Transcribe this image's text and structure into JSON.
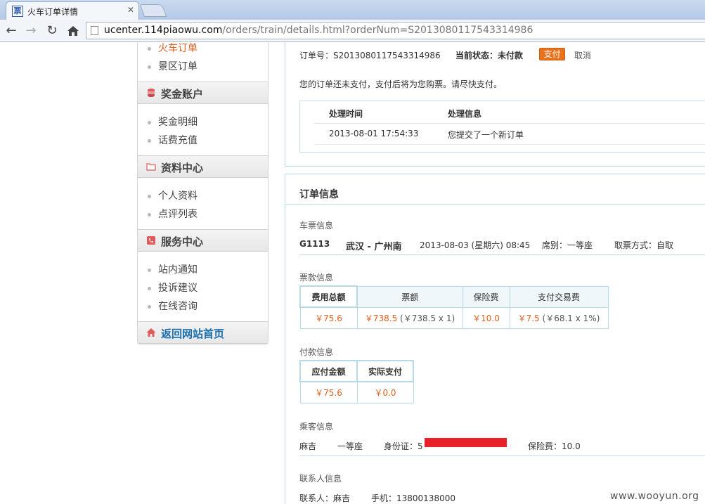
{
  "browser": {
    "tab_title": "火车订单详情",
    "tab_favicon": "票",
    "tab_close": "✕",
    "url_host": "ucenter.114piaowu.com",
    "url_path": "/orders/train/details.html?orderNum=S2013080117543314986"
  },
  "sidebar": {
    "items_top": [
      {
        "label": "火车订单",
        "active": true
      },
      {
        "label": "景区订单"
      }
    ],
    "section_bonus": "奖金账户",
    "items_bonus": [
      "奖金明细",
      "话费充值"
    ],
    "section_profile": "资料中心",
    "items_profile": [
      "个人资料",
      "点评列表"
    ],
    "section_service": "服务中心",
    "items_service": [
      "站内通知",
      "投诉建议",
      "在线咨询"
    ],
    "home_link": "返回网站首页"
  },
  "order": {
    "order_no_label": "订单号：S2013080117543314986",
    "status_label": "当前状态：未付款",
    "pay_button": "支付",
    "cancel_link": "取消",
    "notice": "您的订单还未支付，支付后将为您购票。请尽快支付。",
    "process": {
      "col_time": "处理时间",
      "col_info": "处理信息",
      "time": "2013-08-01 17:54:33",
      "info": "您提交了一个新订单"
    }
  },
  "detail": {
    "title": "订单信息",
    "ticket_section": "车票信息",
    "train_no": "G1113",
    "route": "武汉 - 广州南",
    "depart": "2013-08-03 (星期六) 08:45",
    "seat": "席别：一等座",
    "take_method": "取票方式：自取",
    "fare_section": "票款信息",
    "fare_headers": [
      "费用总额",
      "票额",
      "保险费",
      "支付交易费"
    ],
    "fare_total": "￥75.6",
    "fare_ticket": "￥738.5",
    "fare_ticket_detail": "(￥738.5 x 1)",
    "fare_insurance": "￥10.0",
    "fare_fee": "￥7.5",
    "fare_fee_detail": "(￥68.1 x 1%)",
    "payment_section": "付款信息",
    "payment_headers": [
      "应付金额",
      "实际支付"
    ],
    "payment_due": "￥75.6",
    "payment_paid": "￥0.0",
    "passenger_section": "乘客信息",
    "passenger_name": "麻吉",
    "passenger_seat": "一等座",
    "passenger_id_label": "身份证：5",
    "passenger_insurance": "保险费：10.0",
    "contact_section": "联系人信息",
    "contact_name": "联系人：麻吉",
    "contact_phone": "手机：13800138000"
  },
  "watermark": "www.wooyun.org",
  "colors": {
    "accent": "#e06020",
    "link": "#1a6faf",
    "pay_button": "#e8731e",
    "redaction": "#e8202a"
  }
}
